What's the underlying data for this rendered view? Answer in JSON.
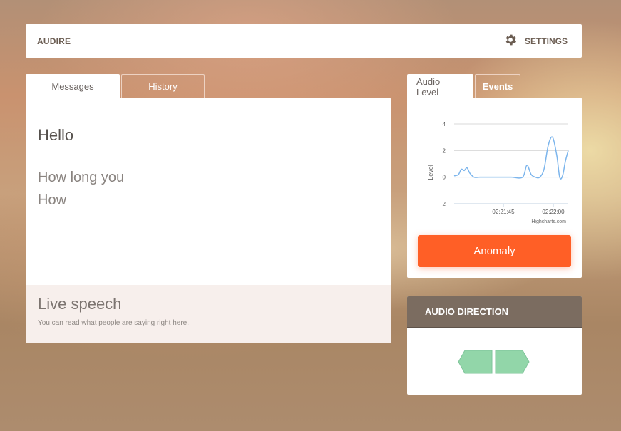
{
  "app": {
    "title": "AUDIRE",
    "settings_label": "SETTINGS"
  },
  "left_tabs": [
    "Messages",
    "History"
  ],
  "right_tabs": [
    "Audio Level",
    "Events"
  ],
  "messages": {
    "first": "Hello",
    "items": [
      "How long you",
      "How"
    ]
  },
  "live": {
    "title": "Live speech",
    "description": "You can read what people are saying right here."
  },
  "audio_level": {
    "ylabel": "Level",
    "credits": "Highcharts.com",
    "anomaly_label": "Anomaly",
    "line_color": "#7cb5ec"
  },
  "chart_data": {
    "type": "line",
    "xlabel": "",
    "ylabel": "Level",
    "ylim": [
      -2,
      4
    ],
    "yticks": [
      4,
      2,
      0,
      -2
    ],
    "xticks": [
      "02:21:45",
      "02:22:00"
    ],
    "grid": true,
    "series": [
      {
        "x": [
          0,
          1.5,
          2.5,
          3.5,
          4.5,
          5.5,
          7,
          9,
          12,
          16,
          20,
          24,
          25.5,
          27,
          28.5,
          30,
          31.5,
          33,
          34.5,
          36,
          37,
          38,
          39,
          40
        ],
        "y": [
          0.1,
          0.2,
          0.6,
          0.5,
          0.7,
          0.3,
          0,
          0,
          0,
          0,
          0,
          0,
          0.9,
          0.2,
          0,
          0,
          0.6,
          2.4,
          3.0,
          1.6,
          0,
          0.1,
          1.2,
          2.0
        ]
      }
    ]
  },
  "direction": {
    "title": "AUDIO DIRECTION",
    "arrow_color": "#92d6a9"
  }
}
